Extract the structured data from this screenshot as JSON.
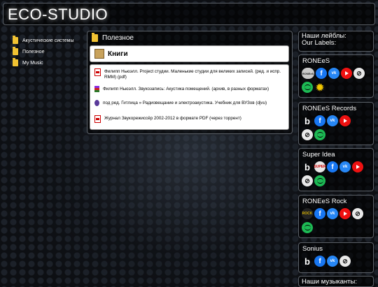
{
  "header": {
    "logo": "ECO-STUDIO"
  },
  "nav": {
    "items": [
      {
        "label": "Акустические системы"
      },
      {
        "label": "Полезное"
      },
      {
        "label": "My Music"
      }
    ]
  },
  "main": {
    "title": "Полезное",
    "section": "Книги",
    "files": [
      {
        "text": "Филипп Ньюэлл. Project студии. Маленькие студии для великих записей. (ред. и испр. RMM) (pdf)",
        "icon": "pdf-icon"
      },
      {
        "text": "Филипп Ньюэлл. Звукозапись: Акустика помещений. (архив, в разных форматах)",
        "icon": "archive-icon"
      },
      {
        "text": "под ред. Гитлица » Радиовещание и электроакустика. Учебник для ВУЗов (djvu)",
        "icon": "djvu-icon"
      },
      {
        "text": "Журнал Звукорежиссёр 2002-2012 в формате PDF (через торрент)",
        "icon": "pdf-icon"
      }
    ]
  },
  "right": {
    "labels_title_1": "Наши лейблы:",
    "labels_title_2": "Our Labels:",
    "cards": [
      {
        "name": "RONEeS"
      },
      {
        "name": "RONEeS Records"
      },
      {
        "name": "Super Idea"
      },
      {
        "name": "RONEeS Rock"
      },
      {
        "name": "Sonius"
      }
    ],
    "next_title": "Наши музыканты:"
  },
  "icons": {
    "facebook": "f",
    "vk": "vk",
    "bandcamp": "b",
    "discogs": "⊘",
    "star": "✹"
  }
}
